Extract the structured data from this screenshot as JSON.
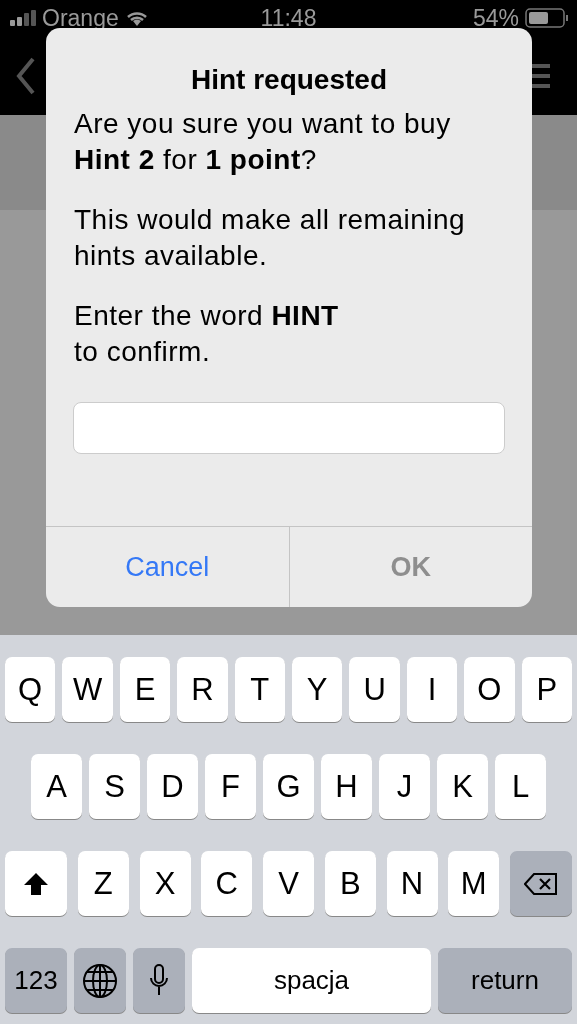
{
  "status_bar": {
    "carrier": "Orange",
    "time": "11:48",
    "battery": "54%"
  },
  "dialog": {
    "title": "Hint requested",
    "paragraphs": [
      "Are you sure you want to buy **Hint 2** for **1 point**?",
      "This would make all remaining hints available.",
      "Enter the word **HINT**\nto confirm."
    ],
    "buttons": [
      {
        "label": "Cancel",
        "disabled": false
      },
      {
        "label": "OK",
        "disabled": true
      }
    ]
  },
  "keyboard": {
    "letter_rows": [
      [
        "Q",
        "W",
        "E",
        "R",
        "T",
        "Y",
        "U",
        "I",
        "O",
        "P"
      ],
      [
        "A",
        "S",
        "D",
        "F",
        "G",
        "H",
        "J",
        "K",
        "L"
      ],
      [
        "Z",
        "X",
        "C",
        "V",
        "B",
        "N",
        "M"
      ]
    ],
    "bottom_row": [
      {
        "kind": "mode",
        "label": "123"
      },
      {
        "kind": "globe"
      },
      {
        "kind": "mic"
      },
      {
        "kind": "space",
        "label": "spacja"
      },
      {
        "kind": "return",
        "label": "return"
      }
    ]
  }
}
